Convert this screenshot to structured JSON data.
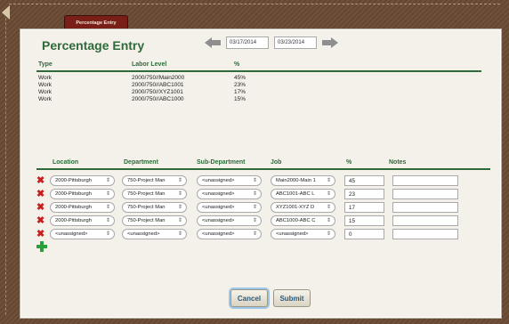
{
  "tab": {
    "label": "Percentage Entry"
  },
  "panel": {
    "title": "Percentage Entry",
    "start_date": "03/17/2014",
    "end_date": "03/23/2014"
  },
  "labor": {
    "headers": {
      "type": "Type",
      "level": "Labor Level",
      "pct": "%"
    },
    "rows": [
      {
        "type": "Work",
        "level": "2000/750//Main2000",
        "pct": "45%"
      },
      {
        "type": "Work",
        "level": "2000/750//ABC1001",
        "pct": "23%"
      },
      {
        "type": "Work",
        "level": "2000/750//XYZ1001",
        "pct": "17%"
      },
      {
        "type": "Work",
        "level": "2000/750//ABC1000",
        "pct": "15%"
      }
    ]
  },
  "entry": {
    "headers": {
      "location": "Location",
      "department": "Department",
      "subdepartment": "Sub-Department",
      "job": "Job",
      "pct": "%",
      "notes": "Notes"
    },
    "rows": [
      {
        "location": "2000-Pittsburgh",
        "department": "750-Project Man",
        "subdepartment": "<unassigned>",
        "job": "Main2000-Main 1",
        "pct": "45",
        "notes": ""
      },
      {
        "location": "2000-Pittsburgh",
        "department": "750-Project Man",
        "subdepartment": "<unassigned>",
        "job": "ABC1001-ABC L",
        "pct": "23",
        "notes": ""
      },
      {
        "location": "2000-Pittsburgh",
        "department": "750-Project Man",
        "subdepartment": "<unassigned>",
        "job": "XYZ1001-XYZ D",
        "pct": "17",
        "notes": ""
      },
      {
        "location": "2000-Pittsburgh",
        "department": "750-Project Man",
        "subdepartment": "<unassigned>",
        "job": "ABC1000-ABC C",
        "pct": "15",
        "notes": ""
      },
      {
        "location": "<unassigned>",
        "department": "<unassigned>",
        "subdepartment": "<unassigned>",
        "job": "<unassigned>",
        "pct": "0",
        "notes": ""
      }
    ]
  },
  "buttons": {
    "cancel": "Cancel",
    "submit": "Submit"
  },
  "colors": {
    "accent_green": "#2e6a3a",
    "delete_red": "#c81e1e",
    "add_green": "#2aa038",
    "tab_maroon": "#7a1f17"
  }
}
